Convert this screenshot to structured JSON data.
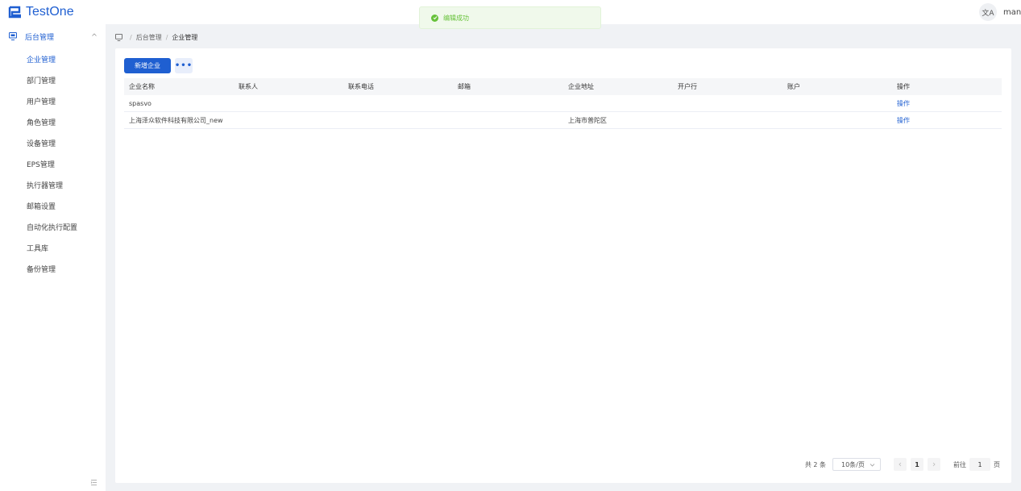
{
  "app": {
    "brand": "TestOne"
  },
  "header": {
    "lang_icon_text": "文A",
    "user": "manager"
  },
  "toast": {
    "message": "编辑成功"
  },
  "sidebar": {
    "group": {
      "label": "后台管理"
    },
    "items": [
      {
        "label": "企业管理",
        "active": true
      },
      {
        "label": "部门管理"
      },
      {
        "label": "用户管理"
      },
      {
        "label": "角色管理"
      },
      {
        "label": "设备管理"
      },
      {
        "label": "EPS管理"
      },
      {
        "label": "执行器管理"
      },
      {
        "label": "邮箱设置"
      },
      {
        "label": "自动化执行配置"
      },
      {
        "label": "工具库"
      },
      {
        "label": "备份管理"
      }
    ]
  },
  "breadcrumb": {
    "parent": "后台管理",
    "current": "企业管理",
    "separator": "/"
  },
  "toolbar": {
    "add_label": "新增企业",
    "more_label": "•••"
  },
  "table": {
    "columns": [
      "企业名称",
      "联系人",
      "联系电话",
      "邮箱",
      "企业地址",
      "开户行",
      "账户",
      "操作"
    ],
    "rows": [
      [
        "spasvo",
        "",
        "",
        "",
        "",
        "",
        "",
        "操作"
      ],
      [
        "上海泽众软件科技有限公司_new",
        "",
        "",
        "",
        "上海市普陀区",
        "",
        "",
        "操作"
      ]
    ]
  },
  "pagination": {
    "total_text": "共 2 条",
    "page_size": "10条/页",
    "current_page": "1",
    "goto_label": "前往",
    "goto_value": "1",
    "page_unit": "页"
  },
  "colors": {
    "primary": "#1f5fd1",
    "success": "#67c23a",
    "background": "#f0f2f5"
  }
}
